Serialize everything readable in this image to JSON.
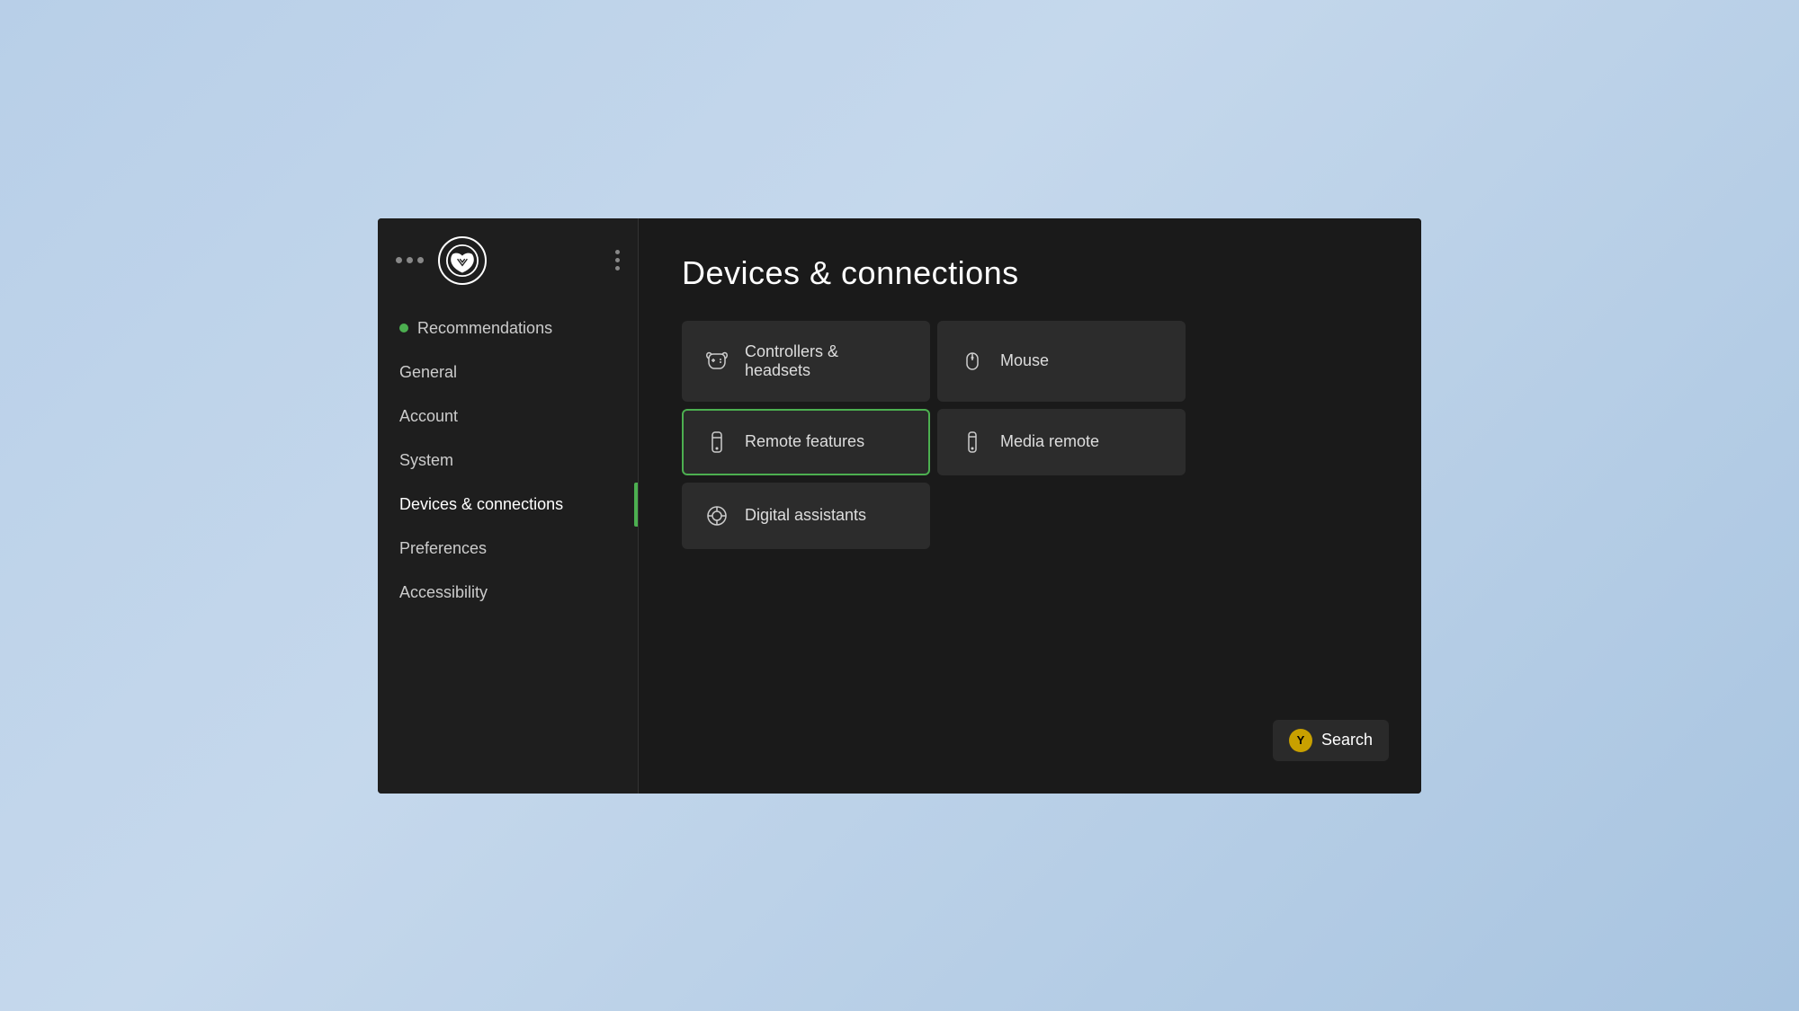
{
  "sidebar": {
    "nav_items": [
      {
        "id": "recommendations",
        "label": "Recommendations",
        "has_dot": true,
        "active": false
      },
      {
        "id": "general",
        "label": "General",
        "has_dot": false,
        "active": false
      },
      {
        "id": "account",
        "label": "Account",
        "has_dot": false,
        "active": false
      },
      {
        "id": "system",
        "label": "System",
        "has_dot": false,
        "active": false
      },
      {
        "id": "devices",
        "label": "Devices & connections",
        "has_dot": false,
        "active": true
      },
      {
        "id": "preferences",
        "label": "Preferences",
        "has_dot": false,
        "active": false
      },
      {
        "id": "accessibility",
        "label": "Accessibility",
        "has_dot": false,
        "active": false
      }
    ]
  },
  "main": {
    "page_title": "Devices & connections",
    "grid_items": [
      {
        "id": "controllers",
        "label": "Controllers & headsets",
        "selected": false
      },
      {
        "id": "mouse",
        "label": "Mouse",
        "selected": false
      },
      {
        "id": "remote_features",
        "label": "Remote features",
        "selected": true
      },
      {
        "id": "media_remote",
        "label": "Media remote",
        "selected": false
      },
      {
        "id": "digital_assistants",
        "label": "Digital assistants",
        "selected": false
      }
    ]
  },
  "search_button": {
    "label": "Search",
    "y_label": "Y"
  }
}
